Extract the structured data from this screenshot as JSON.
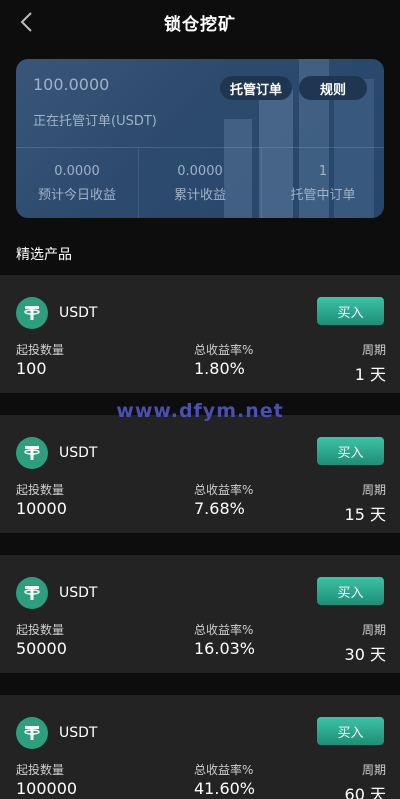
{
  "header": {
    "title": "锁仓挖矿"
  },
  "summary": {
    "amount": "100.0000",
    "label": "正在托管订单(USDT)",
    "orders_button": "托管订单",
    "rules_button": "规则",
    "stats": [
      {
        "value": "0.0000",
        "label": "预计今日收益"
      },
      {
        "value": "0.0000",
        "label": "累计收益"
      },
      {
        "value": "1",
        "label": "托管中订单"
      }
    ]
  },
  "section_title": "精选产品",
  "labels": {
    "min_amount": "起投数量",
    "total_rate": "总收益率%",
    "period": "周期",
    "buy": "买入"
  },
  "products": [
    {
      "coin": "USDT",
      "min": "100",
      "rate": "1.80%",
      "period": "1 天"
    },
    {
      "coin": "USDT",
      "min": "10000",
      "rate": "7.68%",
      "period": "15 天"
    },
    {
      "coin": "USDT",
      "min": "50000",
      "rate": "16.03%",
      "period": "30 天"
    },
    {
      "coin": "USDT",
      "min": "100000",
      "rate": "41.60%",
      "period": "60 天"
    }
  ],
  "watermark": "www.dfym.net",
  "colors": {
    "accent": "#2d9f7e",
    "card": "#2c4a6c",
    "product_bg": "#232323"
  }
}
